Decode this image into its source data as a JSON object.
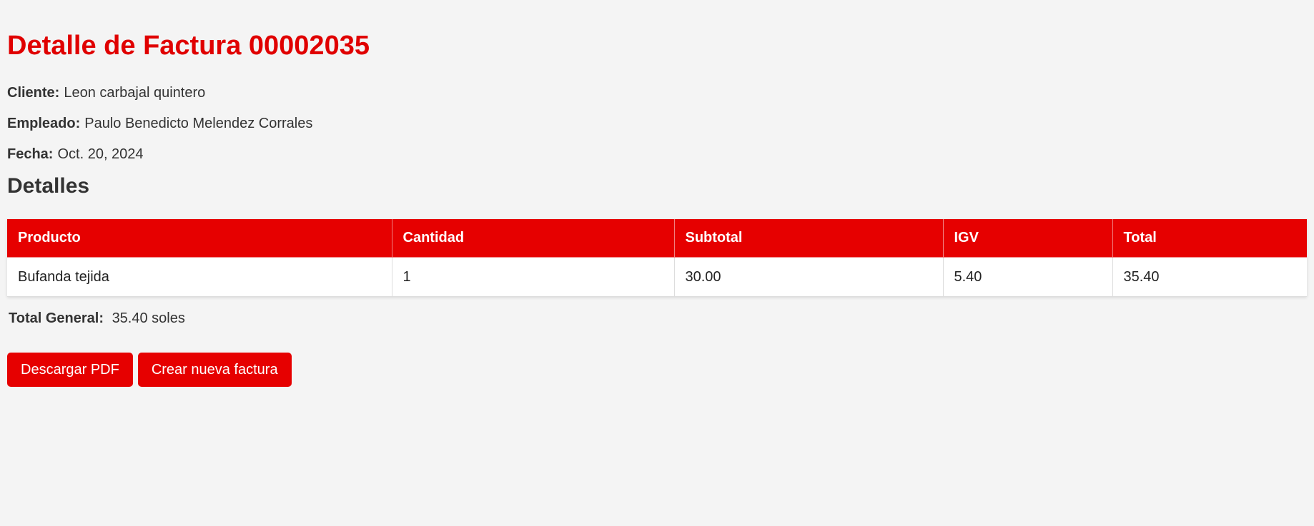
{
  "page": {
    "title": "Detalle de Factura 00002035"
  },
  "invoice": {
    "client_label": "Cliente:",
    "client_value": "Leon carbajal quintero",
    "employee_label": "Empleado:",
    "employee_value": "Paulo Benedicto Melendez Corrales",
    "date_label": "Fecha:",
    "date_value": "Oct. 20, 2024"
  },
  "details": {
    "heading": "Detalles",
    "columns": [
      "Producto",
      "Cantidad",
      "Subtotal",
      "IGV",
      "Total"
    ],
    "rows": [
      [
        "Bufanda tejida",
        "1",
        "30.00",
        "5.40",
        "35.40"
      ]
    ]
  },
  "summary": {
    "total_label": "Total General:",
    "total_value": "35.40 soles"
  },
  "actions": {
    "download_pdf": "Descargar PDF",
    "new_invoice": "Crear nueva factura"
  },
  "colors": {
    "accent": "#e60000",
    "background": "#f4f4f4"
  }
}
